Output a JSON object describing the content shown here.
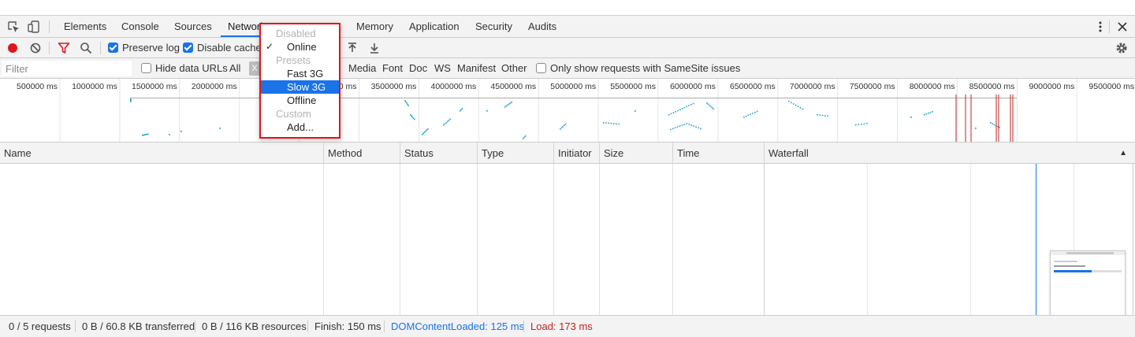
{
  "tabs": {
    "items": [
      "Elements",
      "Console",
      "Sources",
      "Network",
      "Memory",
      "Application",
      "Security",
      "Audits"
    ],
    "active": "Network"
  },
  "toolbar": {
    "preserve_log_label": "Preserve log",
    "preserve_log_checked": true,
    "disable_cache_label": "Disable cache",
    "disable_cache_checked": true
  },
  "filterbar": {
    "filter_placeholder": "Filter",
    "hide_data_urls_label": "Hide data URLs",
    "hide_data_urls_checked": false,
    "type_all": "All",
    "types": [
      "Media",
      "Font",
      "Doc",
      "WS",
      "Manifest",
      "Other"
    ],
    "samesite_label": "Only show requests with SameSite issues",
    "samesite_checked": false
  },
  "overview": {
    "tick_labels": [
      "500000 ms",
      "1000000 ms",
      "1500000 ms",
      "2000000 ms",
      "2",
      "0 ms",
      "3500000 ms",
      "4000000 ms",
      "4500000 ms",
      "5000000 ms",
      "5500000 ms",
      "6000000 ms",
      "6500000 ms",
      "7000000 ms",
      "7500000 ms",
      "8000000 ms",
      "8500000 ms",
      "9000000 ms",
      "9500000 ms"
    ]
  },
  "table": {
    "columns": [
      "Name",
      "Method",
      "Status",
      "Type",
      "Initiator",
      "Size",
      "Time",
      "Waterfall"
    ],
    "sort_indicator": "▲"
  },
  "status": {
    "requests": "0 / 5 requests",
    "transferred": "0 B / 60.8 KB transferred",
    "resources": "0 B / 116 KB resources",
    "finish": "Finish: 150 ms",
    "dom_content_loaded": "DOMContentLoaded: 125 ms",
    "load": "Load: 173 ms"
  },
  "throttle_menu": {
    "disabled_header": "Disabled",
    "online": "Online",
    "online_checked": true,
    "presets_header": "Presets",
    "fast3g": "Fast 3G",
    "slow3g": "Slow 3G",
    "offline": "Offline",
    "custom_header": "Custom",
    "add": "Add...",
    "highlighted": "Slow 3G"
  },
  "colors": {
    "accent": "#1a73e8",
    "record": "#e0161b",
    "dcl": "#1a73e8",
    "load": "#c5221f",
    "highlight_box": "#e0161b"
  },
  "icons": [
    "inspect-element-icon",
    "device-toolbar-icon",
    "record-icon",
    "clear-icon",
    "filter-icon",
    "search-icon",
    "import-har-icon",
    "export-har-icon",
    "more-options-icon",
    "close-icon",
    "settings-icon"
  ]
}
